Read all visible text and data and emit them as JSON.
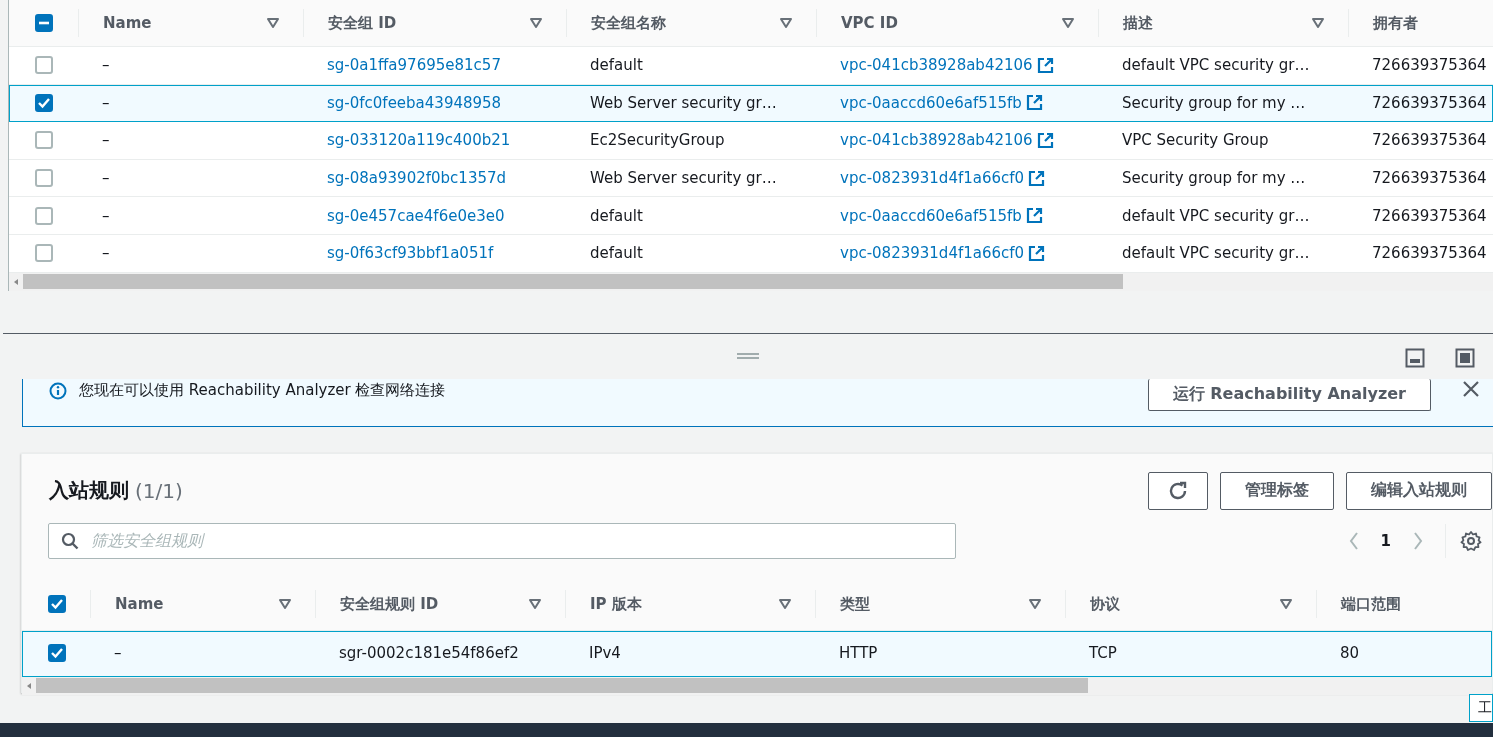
{
  "security_groups": {
    "all_selected": false,
    "partially_selected": true,
    "columns": [
      {
        "label": "Name",
        "kind": "text",
        "filter": true
      },
      {
        "label": "安全组 ID",
        "kind": "link",
        "filter": true
      },
      {
        "label": "安全组名称",
        "kind": "text",
        "filter": true
      },
      {
        "label": "VPC ID",
        "kind": "external_link",
        "filter": true
      },
      {
        "label": "描述",
        "kind": "text",
        "filter": true
      },
      {
        "label": "拥有者",
        "kind": "text",
        "filter": false
      }
    ],
    "rows": [
      {
        "selected": false,
        "cells": [
          "–",
          "sg-0a1ffa97695e81c57",
          "default",
          "vpc-041cb38928ab42106",
          "default VPC security gr…",
          "726639375364"
        ]
      },
      {
        "selected": true,
        "cells": [
          "–",
          "sg-0fc0feeba43948958",
          "Web Server security gr…",
          "vpc-0aaccd60e6af515fb",
          "Security group for my …",
          "726639375364"
        ]
      },
      {
        "selected": false,
        "cells": [
          "–",
          "sg-033120a119c400b21",
          "Ec2SecurityGroup",
          "vpc-041cb38928ab42106",
          "VPC Security Group",
          "726639375364"
        ]
      },
      {
        "selected": false,
        "cells": [
          "–",
          "sg-08a93902f0bc1357d",
          "Web Server security gr…",
          "vpc-0823931d4f1a66cf0",
          "Security group for my …",
          "726639375364"
        ]
      },
      {
        "selected": false,
        "cells": [
          "–",
          "sg-0e457cae4f6e0e3e0",
          "default",
          "vpc-0aaccd60e6af515fb",
          "default VPC security gr…",
          "726639375364"
        ]
      },
      {
        "selected": false,
        "cells": [
          "–",
          "sg-0f63cf93bbf1a051f",
          "default",
          "vpc-0823931d4f1a66cf0",
          "default VPC security gr…",
          "726639375364"
        ]
      }
    ]
  },
  "banner": {
    "text": "您现在可以使用 Reachability Analyzer 检查网络连接",
    "button": "运行 Reachability Analyzer"
  },
  "inbound_rules": {
    "title": "入站规则",
    "count": "(1/1)",
    "buttons": [
      "管理标签",
      "编辑入站规则"
    ],
    "search": {
      "placeholder": "筛选安全组规则"
    },
    "page": "1",
    "all_selected": true,
    "columns": [
      {
        "label": "Name",
        "filter": true
      },
      {
        "label": "安全组规则 ID",
        "filter": true
      },
      {
        "label": "IP 版本",
        "filter": true
      },
      {
        "label": "类型",
        "filter": true
      },
      {
        "label": "协议",
        "filter": true
      },
      {
        "label": "端口范围",
        "filter": false
      }
    ],
    "rows": [
      {
        "selected": true,
        "cells": [
          "–",
          "sgr-0002c181e54f86ef2",
          "IPv4",
          "HTTP",
          "TCP",
          "80"
        ]
      }
    ]
  },
  "tooltip": "工"
}
